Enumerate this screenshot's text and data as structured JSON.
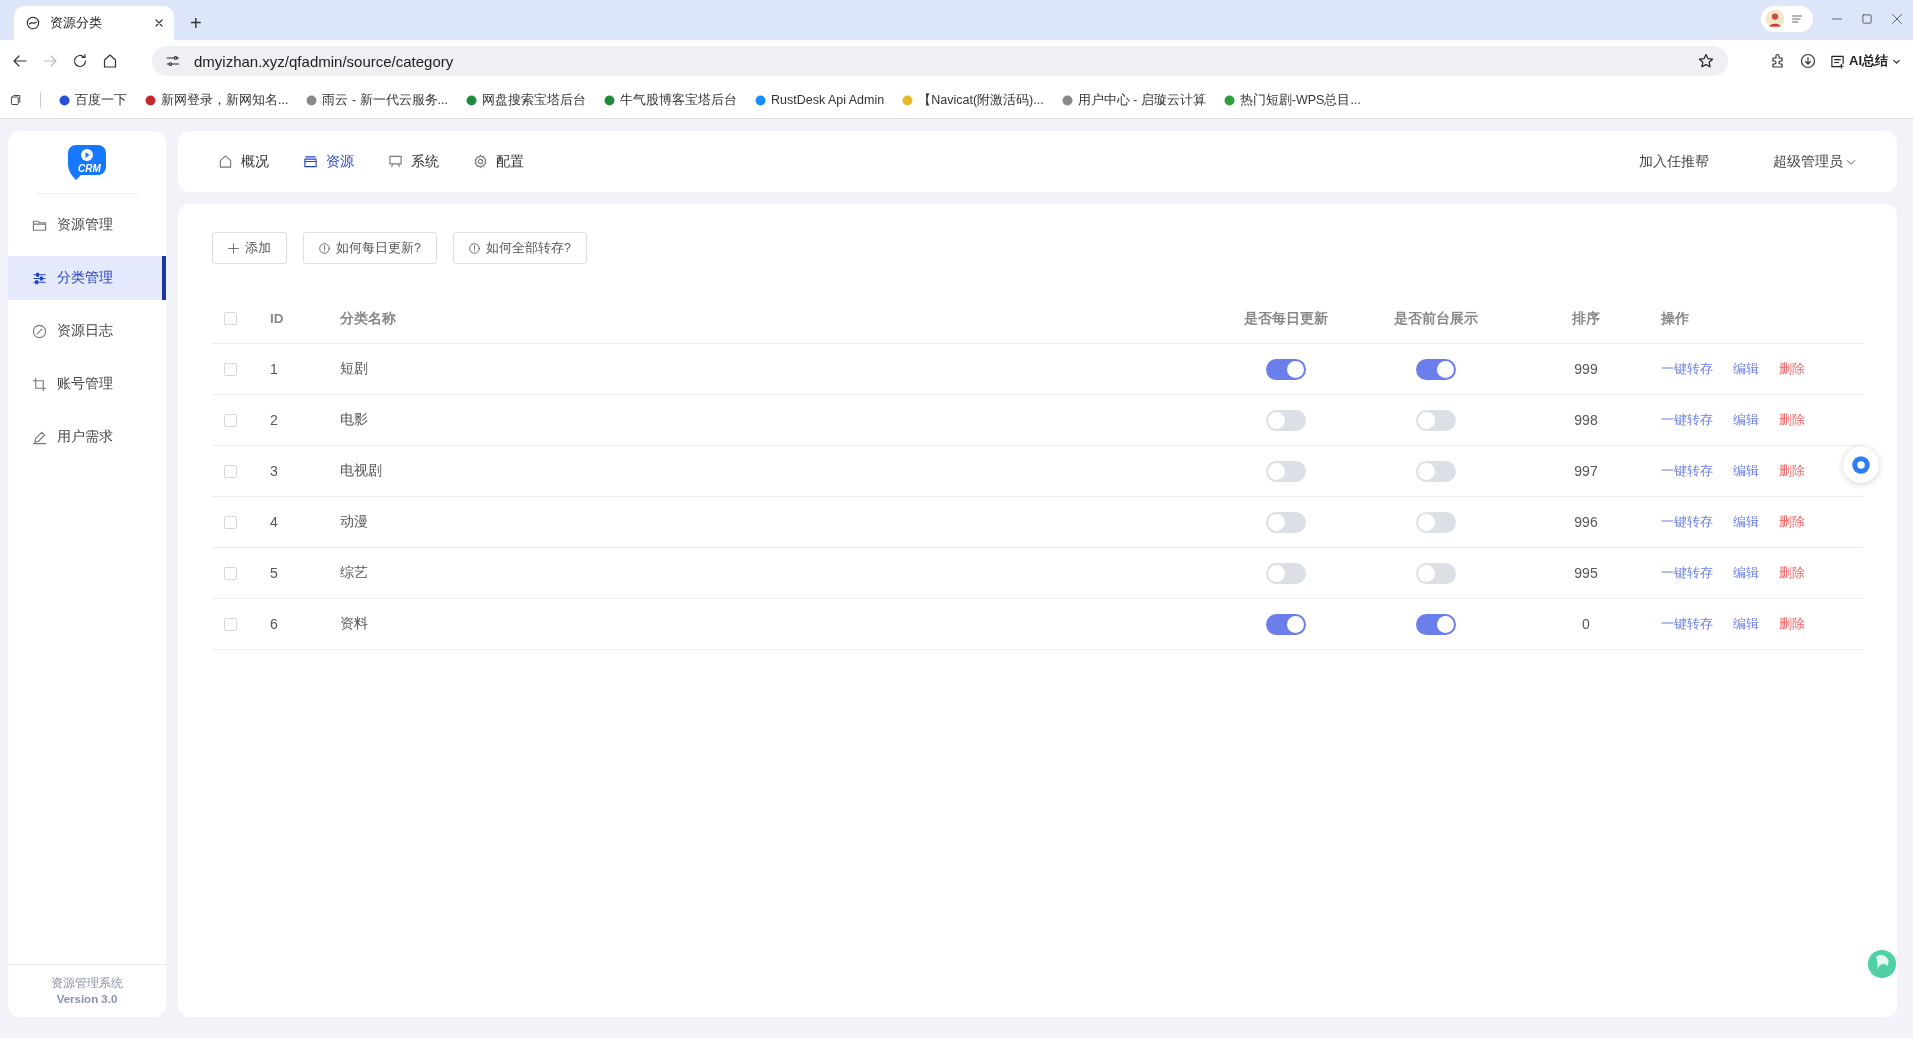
{
  "browser": {
    "tab_title": "资源分类",
    "new_tab": "+",
    "url": "dmyizhan.xyz/qfadmin/source/category",
    "ai_button": "AI总结",
    "bookmarks": [
      {
        "label": "百度一下",
        "color": "#2b4fd8"
      },
      {
        "label": "新网登录，新网知名...",
        "color": "#c0282d"
      },
      {
        "label": "雨云 - 新一代云服务...",
        "color": "#888888"
      },
      {
        "label": "网盘搜索宝塔后台",
        "color": "#1f8a3b"
      },
      {
        "label": "牛气股博客宝塔后台",
        "color": "#1f8a3b"
      },
      {
        "label": "RustDesk Api Admin",
        "color": "#1a8cff"
      },
      {
        "label": "【Navicat(附激活码)...",
        "color": "#e8b923"
      },
      {
        "label": "用户中心 - 启璇云计算",
        "color": "#888888"
      },
      {
        "label": "热门短剧-WPS总目...",
        "color": "#2e9e3a"
      }
    ]
  },
  "sidebar": {
    "logo": "CRM",
    "items": [
      {
        "label": "资源管理",
        "selected": false
      },
      {
        "label": "分类管理",
        "selected": true
      },
      {
        "label": "资源日志",
        "selected": false
      },
      {
        "label": "账号管理",
        "selected": false
      },
      {
        "label": "用户需求",
        "selected": false
      }
    ],
    "footer": {
      "name": "资源管理系统",
      "version": "Version 3.0"
    }
  },
  "topnav": {
    "items": [
      {
        "label": "概况",
        "selected": false
      },
      {
        "label": "资源",
        "selected": true
      },
      {
        "label": "系统",
        "selected": false
      },
      {
        "label": "配置",
        "selected": false
      }
    ],
    "link": "加入任推帮",
    "user": "超级管理员"
  },
  "toolbar": [
    {
      "label": "添加"
    },
    {
      "label": "如何每日更新?"
    },
    {
      "label": "如何全部转存?"
    }
  ],
  "table": {
    "select_all_checked": false,
    "columns": [
      "ID",
      "分类名称",
      "是否每日更新",
      "是否前台展示",
      "排序",
      "操作"
    ],
    "rows": [
      {
        "checked": false,
        "id": "1",
        "name": "短剧",
        "daily_update": true,
        "show_front": true,
        "sort": "999",
        "actions": [
          {
            "label": "一键转存",
            "kind": "link"
          },
          {
            "label": "编辑",
            "kind": "link"
          },
          {
            "label": "删除",
            "kind": "danger"
          }
        ]
      },
      {
        "checked": false,
        "id": "2",
        "name": "电影",
        "daily_update": false,
        "show_front": false,
        "sort": "998",
        "actions": [
          {
            "label": "一键转存",
            "kind": "link"
          },
          {
            "label": "编辑",
            "kind": "link"
          },
          {
            "label": "删除",
            "kind": "danger"
          }
        ]
      },
      {
        "checked": false,
        "id": "3",
        "name": "电视剧",
        "daily_update": false,
        "show_front": false,
        "sort": "997",
        "actions": [
          {
            "label": "一键转存",
            "kind": "link"
          },
          {
            "label": "编辑",
            "kind": "link"
          },
          {
            "label": "删除",
            "kind": "danger"
          }
        ]
      },
      {
        "checked": false,
        "id": "4",
        "name": "动漫",
        "daily_update": false,
        "show_front": false,
        "sort": "996",
        "actions": [
          {
            "label": "一键转存",
            "kind": "link"
          },
          {
            "label": "编辑",
            "kind": "link"
          },
          {
            "label": "删除",
            "kind": "danger"
          }
        ]
      },
      {
        "checked": false,
        "id": "5",
        "name": "综艺",
        "daily_update": false,
        "show_front": false,
        "sort": "995",
        "actions": [
          {
            "label": "一键转存",
            "kind": "link"
          },
          {
            "label": "编辑",
            "kind": "link"
          },
          {
            "label": "删除",
            "kind": "danger"
          }
        ]
      },
      {
        "checked": false,
        "id": "6",
        "name": "资料",
        "daily_update": true,
        "show_front": true,
        "sort": "0",
        "actions": [
          {
            "label": "一键转存",
            "kind": "link"
          },
          {
            "label": "编辑",
            "kind": "link"
          },
          {
            "label": "删除",
            "kind": "danger"
          }
        ]
      }
    ]
  }
}
